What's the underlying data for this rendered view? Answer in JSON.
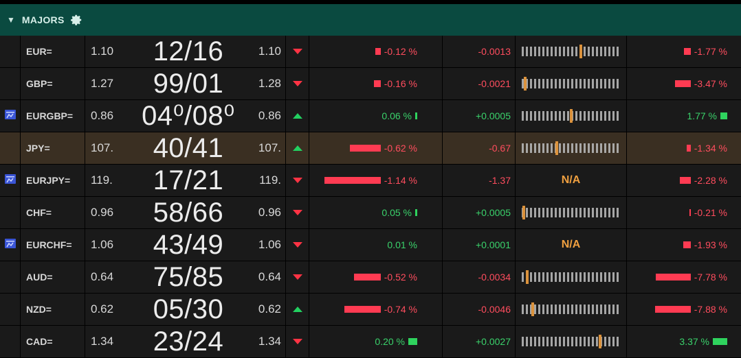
{
  "header": {
    "title": "MAJORS",
    "caret_icon": "triangle-down-icon",
    "settings_icon": "gear-icon"
  },
  "colors": {
    "header_bg": "#0a4a40",
    "negative": "#ff4d5e",
    "positive": "#3ad26b",
    "range_marker": "#f0a040",
    "highlight_row": "#3a2f22"
  },
  "rows": [
    {
      "ric": "EUR=",
      "bid": "1.10",
      "big": "12/16",
      "ask": "1.10",
      "dir": "down",
      "pct": "-0.12 %",
      "pct_bar": 0.1,
      "net": "-0.0013",
      "range": 0.6,
      "ytd": "-1.77 %",
      "ytd_bar": 0.2,
      "icon": false
    },
    {
      "ric": "GBP=",
      "bid": "1.27",
      "big": "99/01",
      "ask": "1.28",
      "dir": "down",
      "pct": "-0.16 %",
      "pct_bar": 0.12,
      "net": "-0.0021",
      "range": 0.02,
      "ytd": "-3.47 %",
      "ytd_bar": 0.45,
      "icon": false
    },
    {
      "ric": "EURGBP=",
      "bid": "0.86",
      "big": "04⁰/08⁰",
      "ask": "0.86",
      "dir": "up",
      "pct": "0.06 %",
      "pct_bar": 0.02,
      "net": "+0.0005",
      "range": 0.5,
      "ytd": "1.77 %",
      "ytd_bar": 0.2,
      "icon": true
    },
    {
      "ric": "JPY=",
      "bid": "107.",
      "big": "40/41",
      "ask": "107.",
      "dir": "up",
      "pct": "-0.62 %",
      "pct_bar": 0.55,
      "net": "-0.67",
      "range": 0.35,
      "ytd": "-1.34 %",
      "ytd_bar": 0.12,
      "icon": false,
      "highlight": true
    },
    {
      "ric": "EURJPY=",
      "bid": "119.",
      "big": "17/21",
      "ask": "119.",
      "dir": "down",
      "pct": "-1.14 %",
      "pct_bar": 1.0,
      "net": "-1.37",
      "range_na": "N/A",
      "ytd": "-2.28 %",
      "ytd_bar": 0.3,
      "icon": true
    },
    {
      "ric": "CHF=",
      "bid": "0.96",
      "big": "58/66",
      "ask": "0.96",
      "dir": "down",
      "pct": "0.05 %",
      "pct_bar": 0.02,
      "net": "+0.0005",
      "range": 0.01,
      "ytd": "-0.21 %",
      "ytd_bar": 0.02,
      "icon": false
    },
    {
      "ric": "EURCHF=",
      "bid": "1.06",
      "big": "43/49",
      "ask": "1.06",
      "dir": "down",
      "pct": "0.01 %",
      "pct_bar": 0,
      "net": "+0.0001",
      "range_na": "N/A",
      "ytd": "-1.93 %",
      "ytd_bar": 0.22,
      "icon": true
    },
    {
      "ric": "AUD=",
      "bid": "0.64",
      "big": "75/85",
      "ask": "0.64",
      "dir": "down",
      "pct": "-0.52 %",
      "pct_bar": 0.47,
      "net": "-0.0034",
      "range": 0.04,
      "ytd": "-7.78 %",
      "ytd_bar": 0.98,
      "icon": false
    },
    {
      "ric": "NZD=",
      "bid": "0.62",
      "big": "05/30",
      "ask": "0.62",
      "dir": "up",
      "pct": "-0.74 %",
      "pct_bar": 0.65,
      "net": "-0.0046",
      "range": 0.1,
      "ytd": "-7.88 %",
      "ytd_bar": 1.0,
      "icon": false
    },
    {
      "ric": "CAD=",
      "bid": "1.34",
      "big": "23/24",
      "ask": "1.34",
      "dir": "down",
      "pct": "0.20 %",
      "pct_bar": 0.16,
      "net": "+0.0027",
      "range": 0.8,
      "ytd": "3.37 %",
      "ytd_bar": 0.4,
      "icon": false
    }
  ]
}
